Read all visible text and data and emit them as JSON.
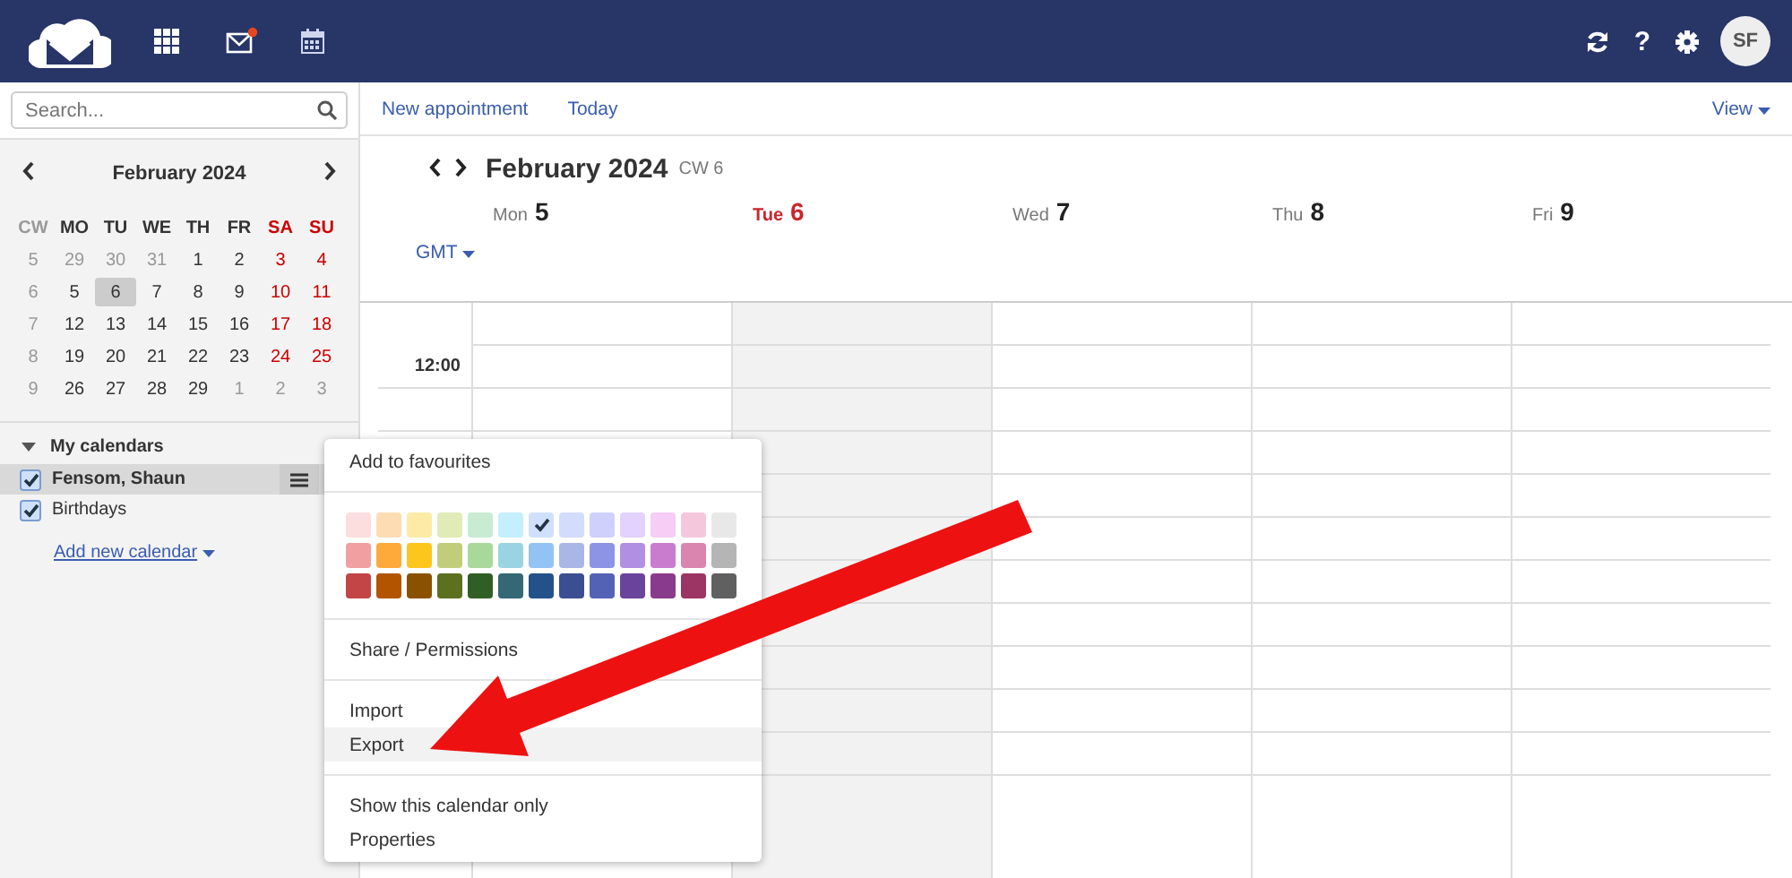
{
  "header": {
    "mail_unread": true,
    "help": "?",
    "avatar": "SF"
  },
  "search": {
    "placeholder": "Search..."
  },
  "mini_calendar": {
    "title": "February 2024",
    "weekdays": [
      "CW",
      "MO",
      "TU",
      "WE",
      "TH",
      "FR",
      "SA",
      "SU"
    ],
    "weeks": [
      {
        "cw": "5",
        "days": [
          {
            "d": "29",
            "outside": true,
            "selected": false
          },
          {
            "d": "30",
            "outside": true,
            "selected": false
          },
          {
            "d": "31",
            "outside": true,
            "selected": false
          },
          {
            "d": "1",
            "outside": false,
            "selected": false
          },
          {
            "d": "2",
            "outside": false,
            "selected": false
          },
          {
            "d": "3",
            "outside": false,
            "selected": false
          },
          {
            "d": "4",
            "outside": false,
            "selected": false
          }
        ]
      },
      {
        "cw": "6",
        "days": [
          {
            "d": "5",
            "outside": false,
            "selected": false
          },
          {
            "d": "6",
            "outside": false,
            "selected": true
          },
          {
            "d": "7",
            "outside": false,
            "selected": false
          },
          {
            "d": "8",
            "outside": false,
            "selected": false
          },
          {
            "d": "9",
            "outside": false,
            "selected": false
          },
          {
            "d": "10",
            "outside": false,
            "selected": false
          },
          {
            "d": "11",
            "outside": false,
            "selected": false
          }
        ]
      },
      {
        "cw": "7",
        "days": [
          {
            "d": "12",
            "outside": false,
            "selected": false
          },
          {
            "d": "13",
            "outside": false,
            "selected": false
          },
          {
            "d": "14",
            "outside": false,
            "selected": false
          },
          {
            "d": "15",
            "outside": false,
            "selected": false
          },
          {
            "d": "16",
            "outside": false,
            "selected": false
          },
          {
            "d": "17",
            "outside": false,
            "selected": false
          },
          {
            "d": "18",
            "outside": false,
            "selected": false
          }
        ]
      },
      {
        "cw": "8",
        "days": [
          {
            "d": "19",
            "outside": false,
            "selected": false
          },
          {
            "d": "20",
            "outside": false,
            "selected": false
          },
          {
            "d": "21",
            "outside": false,
            "selected": false
          },
          {
            "d": "22",
            "outside": false,
            "selected": false
          },
          {
            "d": "23",
            "outside": false,
            "selected": false
          },
          {
            "d": "24",
            "outside": false,
            "selected": false
          },
          {
            "d": "25",
            "outside": false,
            "selected": false
          }
        ]
      },
      {
        "cw": "9",
        "days": [
          {
            "d": "26",
            "outside": false,
            "selected": false
          },
          {
            "d": "27",
            "outside": false,
            "selected": false
          },
          {
            "d": "28",
            "outside": false,
            "selected": false
          },
          {
            "d": "29",
            "outside": false,
            "selected": false
          },
          {
            "d": "1",
            "outside": true,
            "selected": false
          },
          {
            "d": "2",
            "outside": true,
            "selected": false
          },
          {
            "d": "3",
            "outside": true,
            "selected": false
          }
        ]
      }
    ]
  },
  "calendars": {
    "title": "My calendars",
    "expanded": true,
    "items": [
      {
        "name": "Fensom, Shaun",
        "checked": true,
        "selected": true
      },
      {
        "name": "Birthdays",
        "checked": true,
        "selected": false
      }
    ],
    "add_link": "Add new calendar"
  },
  "toolbar": {
    "actions": [
      "New appointment",
      "Today"
    ],
    "view": "View"
  },
  "week": {
    "title": "February 2024",
    "cw": "CW 6",
    "timezone": "GMT",
    "time_label": "12:00",
    "days": [
      {
        "name": "Mon",
        "date": "5",
        "today": false
      },
      {
        "name": "Tue",
        "date": "6",
        "today": true
      },
      {
        "name": "Wed",
        "date": "7",
        "today": false
      },
      {
        "name": "Thu",
        "date": "8",
        "today": false
      },
      {
        "name": "Fri",
        "date": "9",
        "today": false
      }
    ]
  },
  "context_menu": {
    "items_top": [
      {
        "label": "Add to favourites",
        "selected": false
      }
    ],
    "palette": [
      {
        "color": "#fddede",
        "selected": false
      },
      {
        "color": "#fddcb4",
        "selected": false
      },
      {
        "color": "#fdeaa6",
        "selected": false
      },
      {
        "color": "#e1ebb7",
        "selected": false
      },
      {
        "color": "#c7ecd2",
        "selected": false
      },
      {
        "color": "#c4effd",
        "selected": false
      },
      {
        "color": "#cfe0fd",
        "selected": true
      },
      {
        "color": "#d2dcfd",
        "selected": false
      },
      {
        "color": "#d0d0fd",
        "selected": false
      },
      {
        "color": "#e2d2fd",
        "selected": false
      },
      {
        "color": "#f5cdf5",
        "selected": false
      },
      {
        "color": "#f5c7dd",
        "selected": false
      },
      {
        "color": "#e8e8e8",
        "selected": false
      },
      {
        "color": "#f0a0a0",
        "selected": false
      },
      {
        "color": "#fdaa3a",
        "selected": false
      },
      {
        "color": "#fdc61e",
        "selected": false
      },
      {
        "color": "#c2cd7c",
        "selected": false
      },
      {
        "color": "#a8d89a",
        "selected": false
      },
      {
        "color": "#9ad4e3",
        "selected": false
      },
      {
        "color": "#92c3f5",
        "selected": false
      },
      {
        "color": "#a8b8e6",
        "selected": false
      },
      {
        "color": "#8c94e6",
        "selected": false
      },
      {
        "color": "#b190e4",
        "selected": false
      },
      {
        "color": "#c97ccd",
        "selected": false
      },
      {
        "color": "#d985b0",
        "selected": false
      },
      {
        "color": "#b5b5b5",
        "selected": false
      },
      {
        "color": "#c34545",
        "selected": false
      },
      {
        "color": "#b25400",
        "selected": false
      },
      {
        "color": "#8a5200",
        "selected": false
      },
      {
        "color": "#5c7020",
        "selected": false
      },
      {
        "color": "#2f5f25",
        "selected": false
      },
      {
        "color": "#336874",
        "selected": false
      },
      {
        "color": "#23528a",
        "selected": false
      },
      {
        "color": "#3c4e92",
        "selected": false
      },
      {
        "color": "#5462b5",
        "selected": false
      },
      {
        "color": "#6a449c",
        "selected": false
      },
      {
        "color": "#8a3a8c",
        "selected": false
      },
      {
        "color": "#9c3563",
        "selected": false
      },
      {
        "color": "#606060",
        "selected": false
      }
    ],
    "groups": [
      [
        {
          "label": "Share / Permissions",
          "selected": false
        }
      ],
      [
        {
          "label": "Import",
          "selected": false
        },
        {
          "label": "Export",
          "selected": true
        }
      ],
      [
        {
          "label": "Show this calendar only",
          "selected": false
        },
        {
          "label": "Properties",
          "selected": false
        }
      ]
    ]
  }
}
